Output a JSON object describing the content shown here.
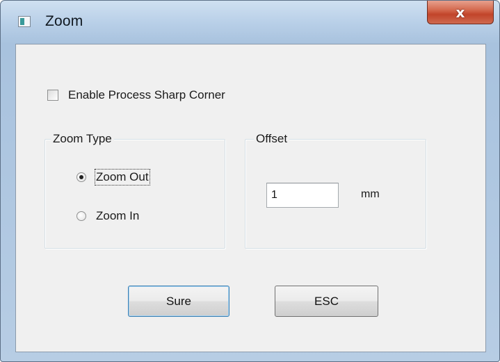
{
  "window": {
    "title": "Zoom",
    "close_glyph": "x"
  },
  "options": {
    "sharp_corner_label": "Enable Process Sharp Corner",
    "sharp_corner_checked": false
  },
  "zoom_type": {
    "legend": "Zoom Type",
    "options": [
      {
        "label": "Zoom Out",
        "selected": true
      },
      {
        "label": "Zoom In",
        "selected": false
      }
    ]
  },
  "offset": {
    "legend": "Offset",
    "value": "1",
    "unit": "mm"
  },
  "buttons": {
    "ok_label": "Sure",
    "cancel_label": "ESC"
  },
  "icons": {
    "app": "window-app-icon",
    "close": "close-icon"
  }
}
